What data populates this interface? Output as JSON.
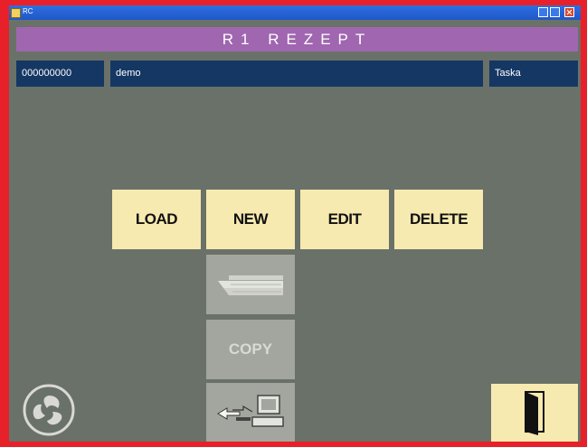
{
  "window": {
    "title": "RC"
  },
  "header": {
    "title": "R1 REZEPT"
  },
  "fields": {
    "id": "000000000",
    "name": "demo",
    "user": "Taska"
  },
  "buttons": {
    "load": "LOAD",
    "new": "NEW",
    "edit": "EDIT",
    "delete": "DELETE",
    "copy": "COPY"
  },
  "colors": {
    "background": "#6a7168",
    "header": "#a066b0",
    "field": "#153764",
    "button": "#f7eab0",
    "disabled": "#a3a69e",
    "frame": "#e8202a"
  },
  "icons": [
    "keyboard-icon",
    "transfer-computer-icon",
    "exit-door-icon",
    "logo-icon"
  ]
}
